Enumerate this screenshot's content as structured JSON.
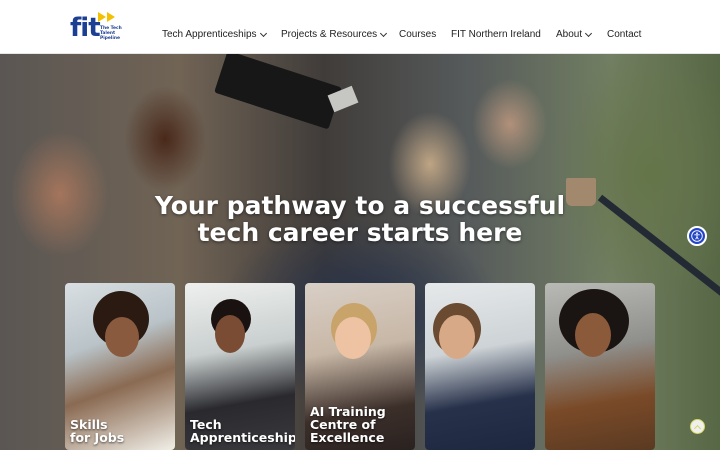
{
  "header": {
    "logo": {
      "wordmark": "fit",
      "tagline": "The Tech Talent Pipeline"
    },
    "nav": [
      {
        "label": "Tech Apprenticeships",
        "has_dropdown": true
      },
      {
        "label": "Projects & Resources",
        "has_dropdown": true
      },
      {
        "label": "Courses",
        "has_dropdown": false
      },
      {
        "label": "FIT Northern Ireland",
        "has_dropdown": false
      },
      {
        "label": "About",
        "has_dropdown": true
      },
      {
        "label": "Contact",
        "has_dropdown": false
      }
    ]
  },
  "hero": {
    "headline_line1": "Your pathway to a successful",
    "headline_line2": "tech career starts here"
  },
  "cards": [
    {
      "title": "Skills\nfor Jobs"
    },
    {
      "title": "Tech\nApprenticeships"
    },
    {
      "title": "AI Training\nCentre of\nExcellence"
    },
    {
      "title": ""
    },
    {
      "title": ""
    }
  ],
  "widgets": {
    "accessibility_icon": "accessibility-icon",
    "back_to_top_icon": "chevron-up-icon"
  },
  "colors": {
    "brand_blue": "#1c3f94",
    "brand_yellow": "#f2c200",
    "accessibility_blue": "#2446c6"
  }
}
